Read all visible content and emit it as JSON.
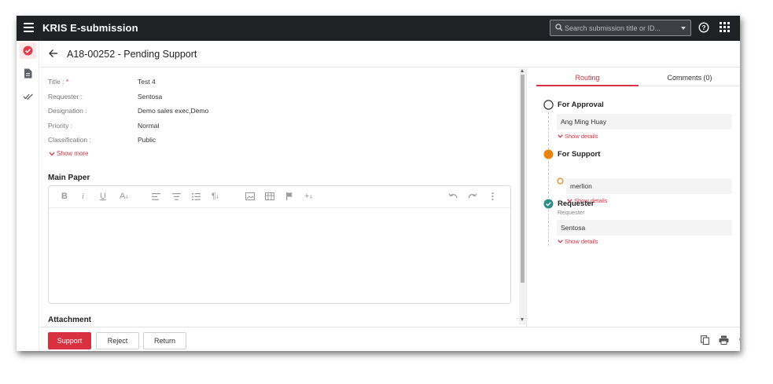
{
  "app": {
    "title": "KRIS E-submission"
  },
  "search": {
    "placeholder": "Search submission title or ID..."
  },
  "header": {
    "title": "A18-00252 - Pending Support"
  },
  "details": {
    "fields": [
      {
        "label": "Title :",
        "value": "Test 4",
        "required": true
      },
      {
        "label": "Requester :",
        "value": "Sentosa"
      },
      {
        "label": "Designation :",
        "value": "Demo sales exec,Demo"
      },
      {
        "label": "Priority :",
        "value": "Normal"
      },
      {
        "label": "Classification :",
        "value": "Public"
      }
    ],
    "show_more": "Show more"
  },
  "main_paper": {
    "title": "Main Paper"
  },
  "attachment": {
    "title": "Attachment"
  },
  "editor": {
    "toolbar": [
      "bold-icon",
      "italic-icon",
      "underline-icon",
      "font-size-icon",
      "align-left-icon",
      "align-center-icon",
      "numbered-list-icon",
      "paragraph-icon",
      "image-icon",
      "table-icon",
      "flag-icon",
      "insert-icon",
      "undo-icon",
      "redo-icon",
      "more-vertical-icon"
    ]
  },
  "tabs": {
    "routing": "Routing",
    "comments": "Comments (0)"
  },
  "routing": {
    "steps": [
      {
        "title": "For Approval",
        "status": "pending",
        "person": "Ang Ming Huay",
        "show_details": "Show details"
      },
      {
        "title": "For Support",
        "status": "current",
        "person": "merlion",
        "show_details": "Show details"
      },
      {
        "title": "Requester",
        "status": "done",
        "subtitle": "Requester",
        "person": "Sentosa",
        "show_details": "Show details"
      }
    ]
  },
  "footer": {
    "support": "Support",
    "reject": "Reject",
    "return": "Return"
  },
  "colors": {
    "topbar": "#202124",
    "accent": "#d9303f",
    "current": "#e8840f",
    "done": "#2e8f8a"
  }
}
